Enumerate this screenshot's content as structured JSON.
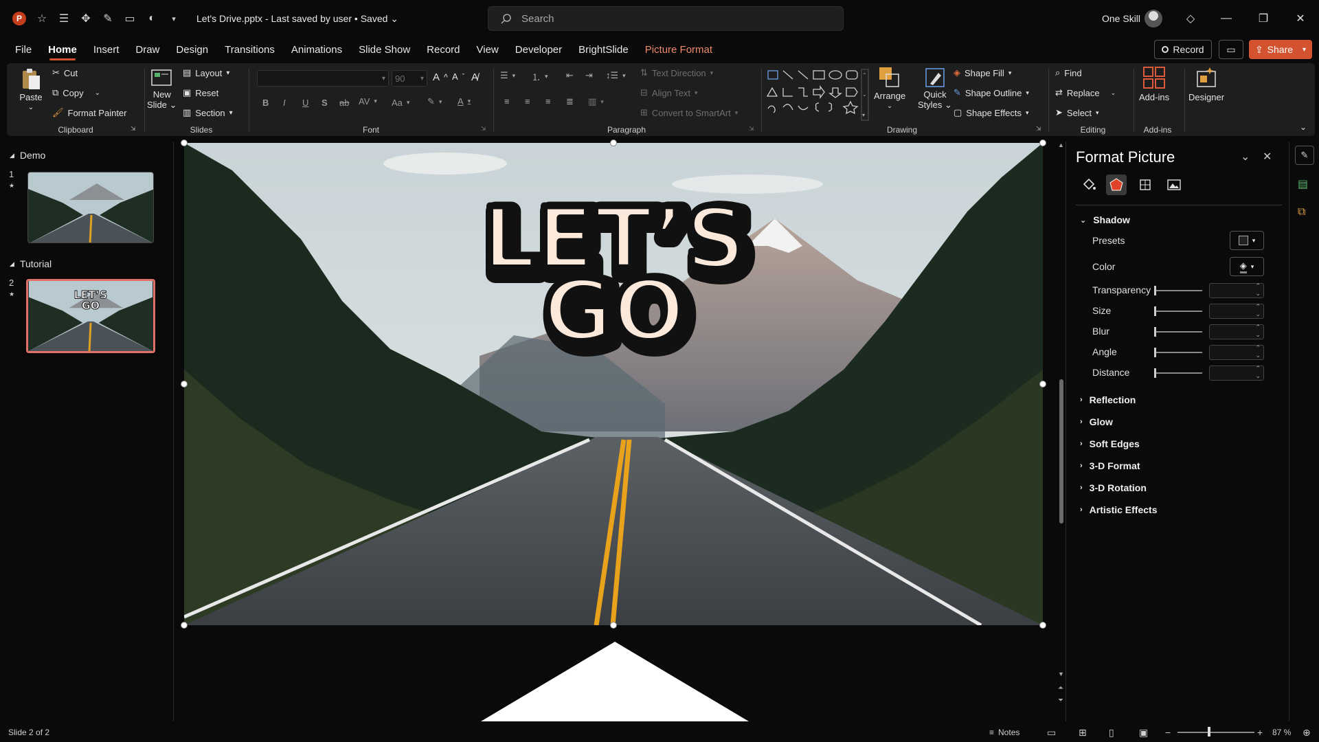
{
  "titlebar": {
    "doc_name": "Let's Drive.pptx",
    "save_status": "Last saved by user • Saved",
    "search_placeholder": "Search",
    "user_name": "One Skill"
  },
  "menu": {
    "tabs": [
      "File",
      "Home",
      "Insert",
      "Draw",
      "Design",
      "Transitions",
      "Animations",
      "Slide Show",
      "Record",
      "View",
      "Developer",
      "BrightSlide",
      "Picture Format"
    ],
    "active_tab": "Home",
    "record_label": "Record",
    "share_label": "Share"
  },
  "ribbon": {
    "clipboard": {
      "paste": "Paste",
      "cut": "Cut",
      "copy": "Copy",
      "format_painter": "Format Painter",
      "label": "Clipboard"
    },
    "slides": {
      "new_slide": "New",
      "new_slide_2": "Slide",
      "layout": "Layout",
      "reset": "Reset",
      "section": "Section",
      "label": "Slides"
    },
    "font": {
      "font_size": "90",
      "label": "Font"
    },
    "paragraph": {
      "text_direction": "Text Direction",
      "align_text": "Align Text",
      "convert_smartart": "Convert to SmartArt",
      "label": "Paragraph"
    },
    "drawing": {
      "arrange": "Arrange",
      "quick_styles": "Quick",
      "quick_styles_2": "Styles",
      "shape_fill": "Shape Fill",
      "shape_outline": "Shape Outline",
      "shape_effects": "Shape Effects",
      "label": "Drawing"
    },
    "editing": {
      "find": "Find",
      "replace": "Replace",
      "select": "Select",
      "label": "Editing"
    },
    "addins": {
      "addins": "Add-ins",
      "label": "Add-ins"
    },
    "designer": {
      "designer": "Designer"
    }
  },
  "slide_pane": {
    "sections": [
      {
        "name": "Demo",
        "slide_number": "1"
      },
      {
        "name": "Tutorial",
        "slide_number": "2"
      }
    ]
  },
  "slide": {
    "headline_line1": "LET’S",
    "headline_line2": "GO"
  },
  "format_pane": {
    "title": "Format Picture",
    "shadow": {
      "heading": "Shadow",
      "presets": "Presets",
      "color": "Color",
      "transparency": "Transparency",
      "size": "Size",
      "blur": "Blur",
      "angle": "Angle",
      "distance": "Distance"
    },
    "collapsed_sections": [
      "Reflection",
      "Glow",
      "Soft Edges",
      "3-D Format",
      "3-D Rotation",
      "Artistic Effects"
    ]
  },
  "statusbar": {
    "slide_info": "Slide 2 of 2",
    "notes": "Notes",
    "zoom": "87 %"
  },
  "colors": {
    "accent": "#d35230",
    "background": "#0a0a0a",
    "ribbon": "#1e1e1e"
  }
}
